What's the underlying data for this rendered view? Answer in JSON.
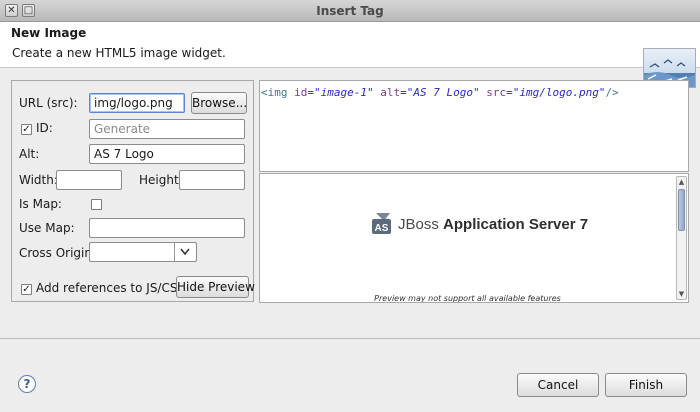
{
  "window": {
    "title": "Insert Tag"
  },
  "header": {
    "title": "New Image",
    "description": "Create a new HTML5 image widget."
  },
  "form": {
    "url_label": "URL (src):",
    "url_value": "img/logo.png",
    "browse_label": "Browse...",
    "id_label": "ID:",
    "id_checked": true,
    "id_placeholder": "Generate",
    "alt_label": "Alt:",
    "alt_value": "AS 7 Logo",
    "width_label": "Width:",
    "width_value": "",
    "height_label": "Height:",
    "height_value": "",
    "ismap_label": "Is Map:",
    "ismap_checked": false,
    "usemap_label": "Use Map:",
    "usemap_value": "",
    "crossorigin_label": "Cross Origin:",
    "crossorigin_value": "",
    "add_refs_label": "Add references to JS/CSS",
    "add_refs_checked": true,
    "hide_preview_label": "Hide Preview"
  },
  "code": {
    "open": "<img",
    "attr1": "id",
    "val1": "\"image-1\"",
    "attr2": "alt",
    "val2": "\"AS 7 Logo\"",
    "attr3": "src",
    "val3": "\"img/logo.png\"",
    "close": "/>"
  },
  "preview": {
    "logo_badge": "AS",
    "logo_text_light": "JBoss",
    "logo_text_bold": "Application Server 7",
    "note": "Preview may not support all available features"
  },
  "footer": {
    "cancel_label": "Cancel",
    "finish_label": "Finish",
    "help_icon": "?"
  },
  "colors": {
    "focus": "#5b87c7",
    "tag": "#3b7a8c",
    "attr": "#7a3c8c",
    "value": "#2a28c8"
  }
}
